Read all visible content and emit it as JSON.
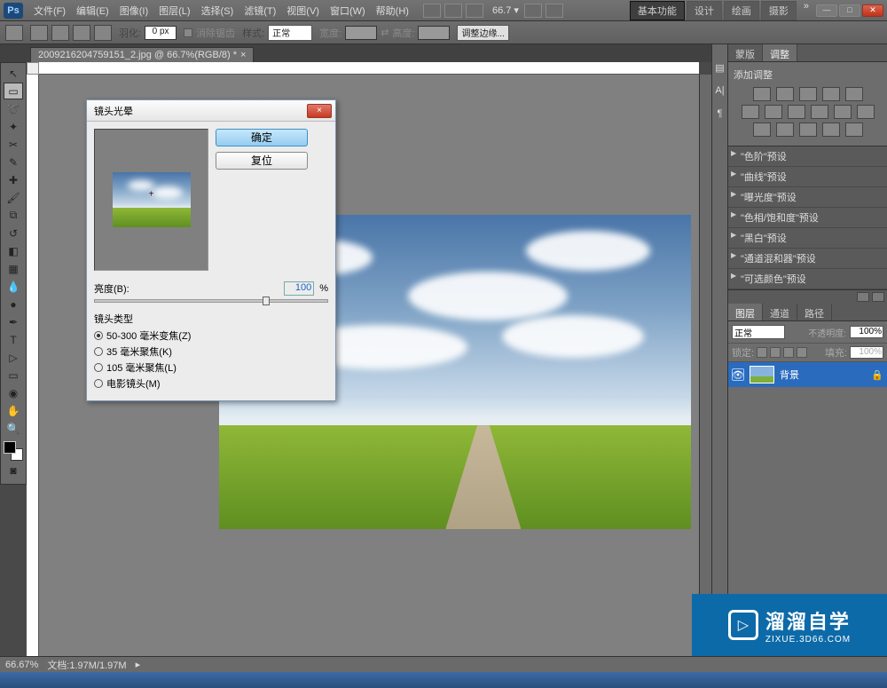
{
  "app": {
    "logo": "Ps"
  },
  "menus": [
    "文件(F)",
    "编辑(E)",
    "图像(I)",
    "图层(L)",
    "选择(S)",
    "滤镜(T)",
    "视图(V)",
    "窗口(W)",
    "帮助(H)"
  ],
  "topbar": {
    "zoom": "66.7",
    "chev": "»"
  },
  "workspaces": [
    "基本功能",
    "设计",
    "绘画",
    "摄影"
  ],
  "options": {
    "feather_label": "羽化:",
    "feather_value": "0 px",
    "antialias": "消除锯齿",
    "style_label": "样式:",
    "style_value": "正常",
    "width_label": "宽度:",
    "height_label": "高度:",
    "refine": "调整边缘..."
  },
  "doc_tab": {
    "name": "2009216204759151_2.jpg @ 66.7%(RGB/8) *",
    "close": "×"
  },
  "dialog": {
    "title": "镜头光晕",
    "ok": "确定",
    "reset": "复位",
    "brightness_label": "亮度(B):",
    "brightness_value": "100",
    "brightness_unit": "%",
    "lens_legend": "镜头类型",
    "lenses": [
      {
        "label": "50-300 毫米变焦(Z)",
        "checked": true
      },
      {
        "label": "35 毫米聚焦(K)",
        "checked": false
      },
      {
        "label": "105 毫米聚焦(L)",
        "checked": false
      },
      {
        "label": "电影镜头(M)",
        "checked": false
      }
    ],
    "close": "×"
  },
  "right": {
    "tabs_top": [
      "蒙版",
      "调整"
    ],
    "adj_title": "添加调整",
    "presets": [
      "\"色阶\"预设",
      "\"曲线\"预设",
      "\"曝光度\"预设",
      "\"色相/饱和度\"预设",
      "\"黑白\"预设",
      "\"通道混和器\"预设",
      "\"可选颜色\"预设"
    ],
    "tabs_layers": [
      "图层",
      "通道",
      "路径"
    ],
    "blend_mode": "正常",
    "opacity_label": "不透明度:",
    "opacity_value": "100%",
    "lock_label": "锁定:",
    "fill_label": "填充:",
    "fill_value": "100%",
    "layer_name": "背景"
  },
  "status": {
    "zoom": "66.67%",
    "doc": "文档:1.97M/1.97M"
  },
  "watermark": {
    "big": "溜溜自学",
    "small": "ZIXUE.3D66.COM",
    "play": "▷"
  }
}
